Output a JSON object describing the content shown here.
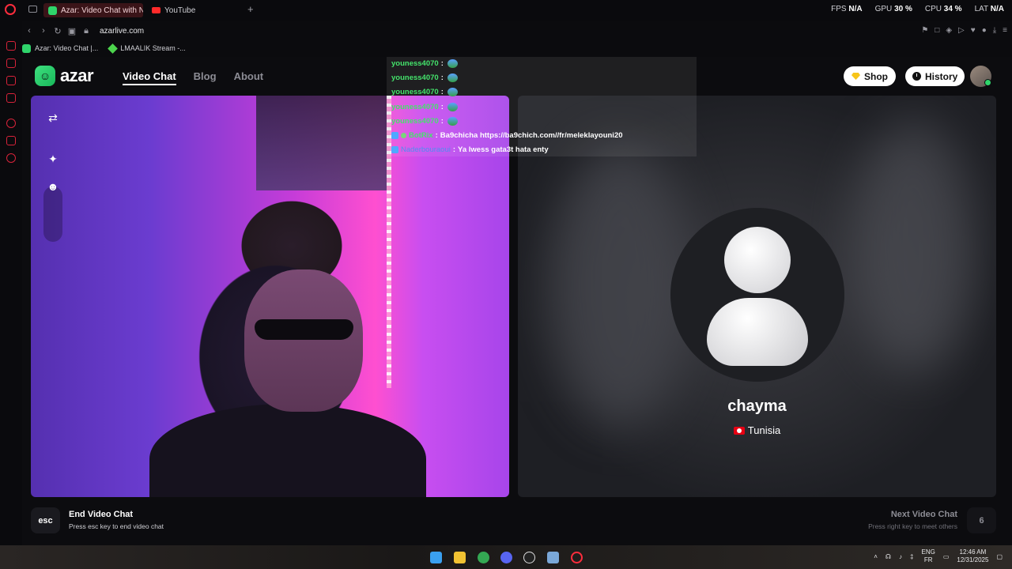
{
  "browser": {
    "tabs": [
      {
        "label": "Azar: Video Chat with Ne"
      },
      {
        "label": "YouTube"
      }
    ],
    "new_tab_label": "+",
    "stats": {
      "fps_label": "FPS",
      "fps_value": "N/A",
      "gpu_label": "GPU",
      "gpu_value": "30 %",
      "cpu_label": "CPU",
      "cpu_value": "34 %",
      "lat_label": "LAT",
      "lat_value": "N/A"
    },
    "url": "azarlive.com",
    "bookmarks": [
      {
        "label": "Azar: Video Chat |..."
      },
      {
        "label": "LMAALIK Stream -..."
      }
    ]
  },
  "header": {
    "logo_text": "azar",
    "nav": [
      {
        "label": "Video Chat"
      },
      {
        "label": "Blog"
      },
      {
        "label": "About"
      }
    ],
    "shop_label": "Shop",
    "history_label": "History"
  },
  "chat": [
    {
      "user": "youness4070",
      "sep": ":",
      "text": ""
    },
    {
      "user": "youness4070",
      "sep": ":",
      "text": ""
    },
    {
      "user": "youness4070",
      "sep": ":",
      "text": ""
    },
    {
      "user": "youness4070",
      "sep": ":",
      "text": ""
    },
    {
      "user": "youness4070",
      "sep": ":",
      "text": ""
    },
    {
      "user": "BotRix",
      "sep": ":",
      "text": "Ba9chicha https://ba9chich.com//fr/meleklayouni20"
    },
    {
      "user": "Naderbouraoui",
      "sep": ":",
      "text": "Ya lwess gata3t hata enty"
    }
  ],
  "partner": {
    "name": "chayma",
    "country": "Tunisia"
  },
  "footer": {
    "esc_key": "esc",
    "end_title": "End Video Chat",
    "end_sub": "Press esc key to end video chat",
    "next_title": "Next Video Chat",
    "next_sub": "Press right key to meet others",
    "next_key": "6"
  },
  "taskbar": {
    "lang_top": "ENG",
    "lang_bottom": "FR",
    "time": "12:46 AM",
    "date": "12/31/2025"
  },
  "colors": {
    "accent_green": "#2fd46b",
    "opera_red": "#ff2d3d"
  }
}
